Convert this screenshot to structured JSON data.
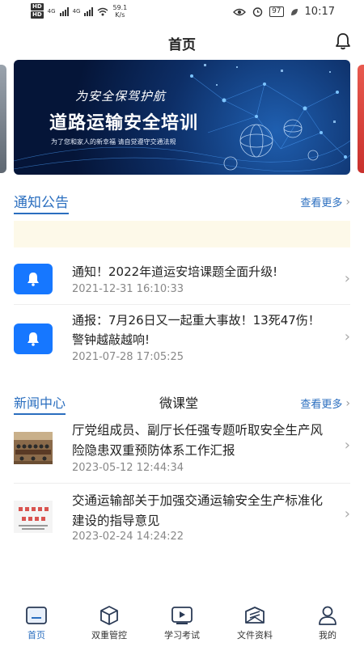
{
  "status_bar": {
    "hd1": "HD",
    "hd2": "HD",
    "net1": "4G",
    "net2": "4G",
    "speed_value": "59.1",
    "speed_unit": "K/s",
    "battery": "97",
    "time": "10:17"
  },
  "header": {
    "title": "首页"
  },
  "banner": {
    "tagline": "为安全保驾护航",
    "title": "道路运输安全培训",
    "subtitle": "为了您和家人的新幸福 请自觉遵守交通法规"
  },
  "notices": {
    "title": "通知公告",
    "more_label": "查看更多",
    "items": [
      {
        "title": "通知！2022年道运安培课题全面升级!",
        "time": "2021-12-31 16:10:33"
      },
      {
        "title": "通报：7月26日又一起重大事故！13死47伤！警钟越敲越响!",
        "time": "2021-07-28 17:05:25"
      }
    ]
  },
  "news": {
    "tabs": [
      "新闻中心",
      "微课堂"
    ],
    "more_label": "查看更多",
    "items": [
      {
        "title": "厅党组成员、副厅长任强专题听取安全生产风险隐患双重预防体系工作汇报",
        "time": "2023-05-12 12:44:34"
      },
      {
        "title": "交通运输部关于加强交通运输安全生产标准化建设的指导意见",
        "time": "2023-02-24 14:24:22"
      }
    ]
  },
  "bottom_nav": {
    "items": [
      {
        "label": "首页",
        "icon": "home-icon",
        "active": true
      },
      {
        "label": "双重管控",
        "icon": "cube-icon",
        "active": false
      },
      {
        "label": "学习考试",
        "icon": "play-icon",
        "active": false
      },
      {
        "label": "文件资料",
        "icon": "folder-icon",
        "active": false
      },
      {
        "label": "我的",
        "icon": "user-icon",
        "active": false
      }
    ]
  },
  "colors": {
    "accent": "#2a6ebf",
    "icon_blue": "#1677ff",
    "marquee_bg": "#fdf9e9"
  }
}
